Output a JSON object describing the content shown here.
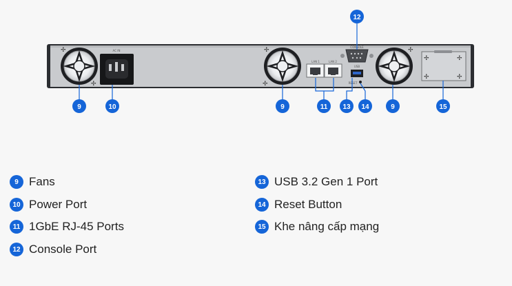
{
  "device": {
    "silk_power": "AC IN",
    "silk_lan1": "LAN 1",
    "silk_lan2": "LAN 2",
    "silk_console": "CONSOLE",
    "silk_usb": "USB",
    "silk_reset": "RESET"
  },
  "callouts": {
    "fan_left": "9",
    "power": "10",
    "fan_mid": "9",
    "lan": "11",
    "usb": "13",
    "reset": "14",
    "fan_right": "9",
    "console": "12",
    "expansion": "15"
  },
  "legend": [
    {
      "number": "9",
      "label": "Fans"
    },
    {
      "number": "10",
      "label": "Power Port"
    },
    {
      "number": "11",
      "label": "1GbE RJ-45 Ports"
    },
    {
      "number": "12",
      "label": "Console Port"
    },
    {
      "number": "13",
      "label": "USB 3.2 Gen 1 Port"
    },
    {
      "number": "14",
      "label": "Reset Button"
    },
    {
      "number": "15",
      "label": "Khe nâng cấp mạng"
    }
  ],
  "colors": {
    "badge": "#1565d8",
    "chassis": "#c9cbce",
    "chassis_edge": "#2b2d31",
    "leader_line": "#1565d8"
  }
}
